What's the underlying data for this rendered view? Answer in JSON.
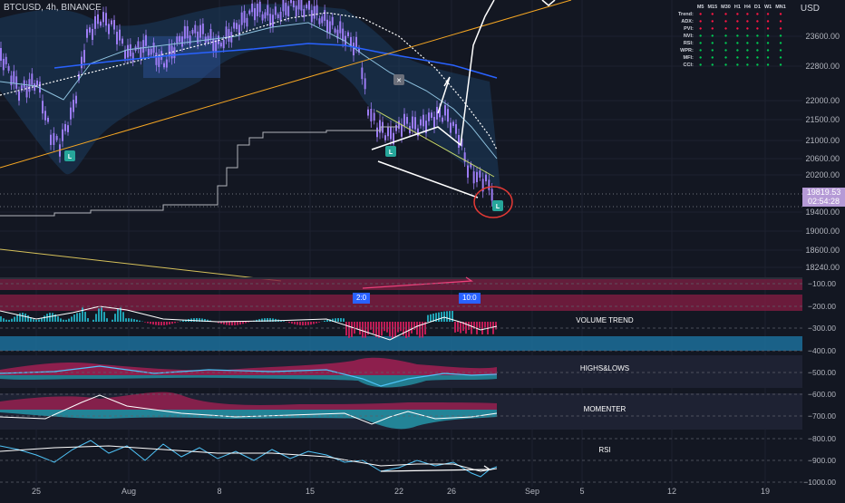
{
  "header": {
    "symbol": "BTCUSD, 4h, BINANCE",
    "currency": "USD"
  },
  "price_axis": {
    "ticks": [
      "23600.00",
      "22800.00",
      "22000.00",
      "21500.00",
      "21000.00",
      "20600.00",
      "20200.00",
      "19400.00",
      "19000.00",
      "18600.00",
      "18240.00"
    ],
    "current_price": "19819.53",
    "countdown": "02:54:28"
  },
  "oscillator_axis": {
    "ticks": [
      "−100.00",
      "−200.00",
      "−300.00",
      "−400.00",
      "−500.00",
      "−600.00",
      "−700.00",
      "−800.00",
      "−900.00",
      "−1000.00"
    ]
  },
  "time_axis": {
    "ticks": [
      "25",
      "Aug",
      "8",
      "15",
      "22",
      "26",
      "Sep",
      "5",
      "12",
      "19"
    ]
  },
  "status_table": {
    "columns": [
      "M5",
      "M15",
      "M30",
      "H1",
      "H4",
      "D1",
      "W1",
      "MN1"
    ],
    "rows": [
      {
        "label": "Trend:",
        "cells": [
          "d",
          "d",
          "d",
          "d",
          "d",
          "d",
          "d",
          "d"
        ]
      },
      {
        "label": "ADX:",
        "cells": [
          "d",
          "d",
          "d",
          "d",
          "d",
          "d",
          "d",
          "d"
        ]
      },
      {
        "label": "PVI:",
        "cells": [
          "d",
          "d",
          "d",
          "d",
          "d",
          "d",
          "d",
          "d"
        ]
      },
      {
        "label": "NVI:",
        "cells": [
          "u",
          "u",
          "u",
          "u",
          "u",
          "u",
          "u",
          "u"
        ]
      },
      {
        "label": "RSI:",
        "cells": [
          "u",
          "u",
          "u",
          "u",
          "u",
          "u",
          "u",
          "u"
        ]
      },
      {
        "label": "WPR:",
        "cells": [
          "u",
          "u",
          "u",
          "u",
          "u",
          "u",
          "u",
          "u"
        ]
      },
      {
        "label": "MFI:",
        "cells": [
          "u",
          "u",
          "u",
          "u",
          "u",
          "u",
          "u",
          "u"
        ]
      },
      {
        "label": "CCI:",
        "cells": [
          "u",
          "u",
          "u",
          "u",
          "u",
          "u",
          "u",
          "u"
        ]
      }
    ],
    "colors": {
      "up": "#00c853",
      "down": "#ff1744"
    }
  },
  "indicator_panels": [
    "VOLUME TREND",
    "HIGHS&LOWS",
    "MOMENTER",
    "RSI"
  ],
  "markers": {
    "low_label": "L",
    "x_label": "✕"
  },
  "badges": [
    "2:0",
    "10:0"
  ],
  "colors": {
    "background": "#131722",
    "candle": "#9c7cf4",
    "accent_blue": "#2962ff",
    "bear_red": "#e91e63",
    "bull_cyan": "#26c6da",
    "price_tag": "#b59ad6"
  }
}
